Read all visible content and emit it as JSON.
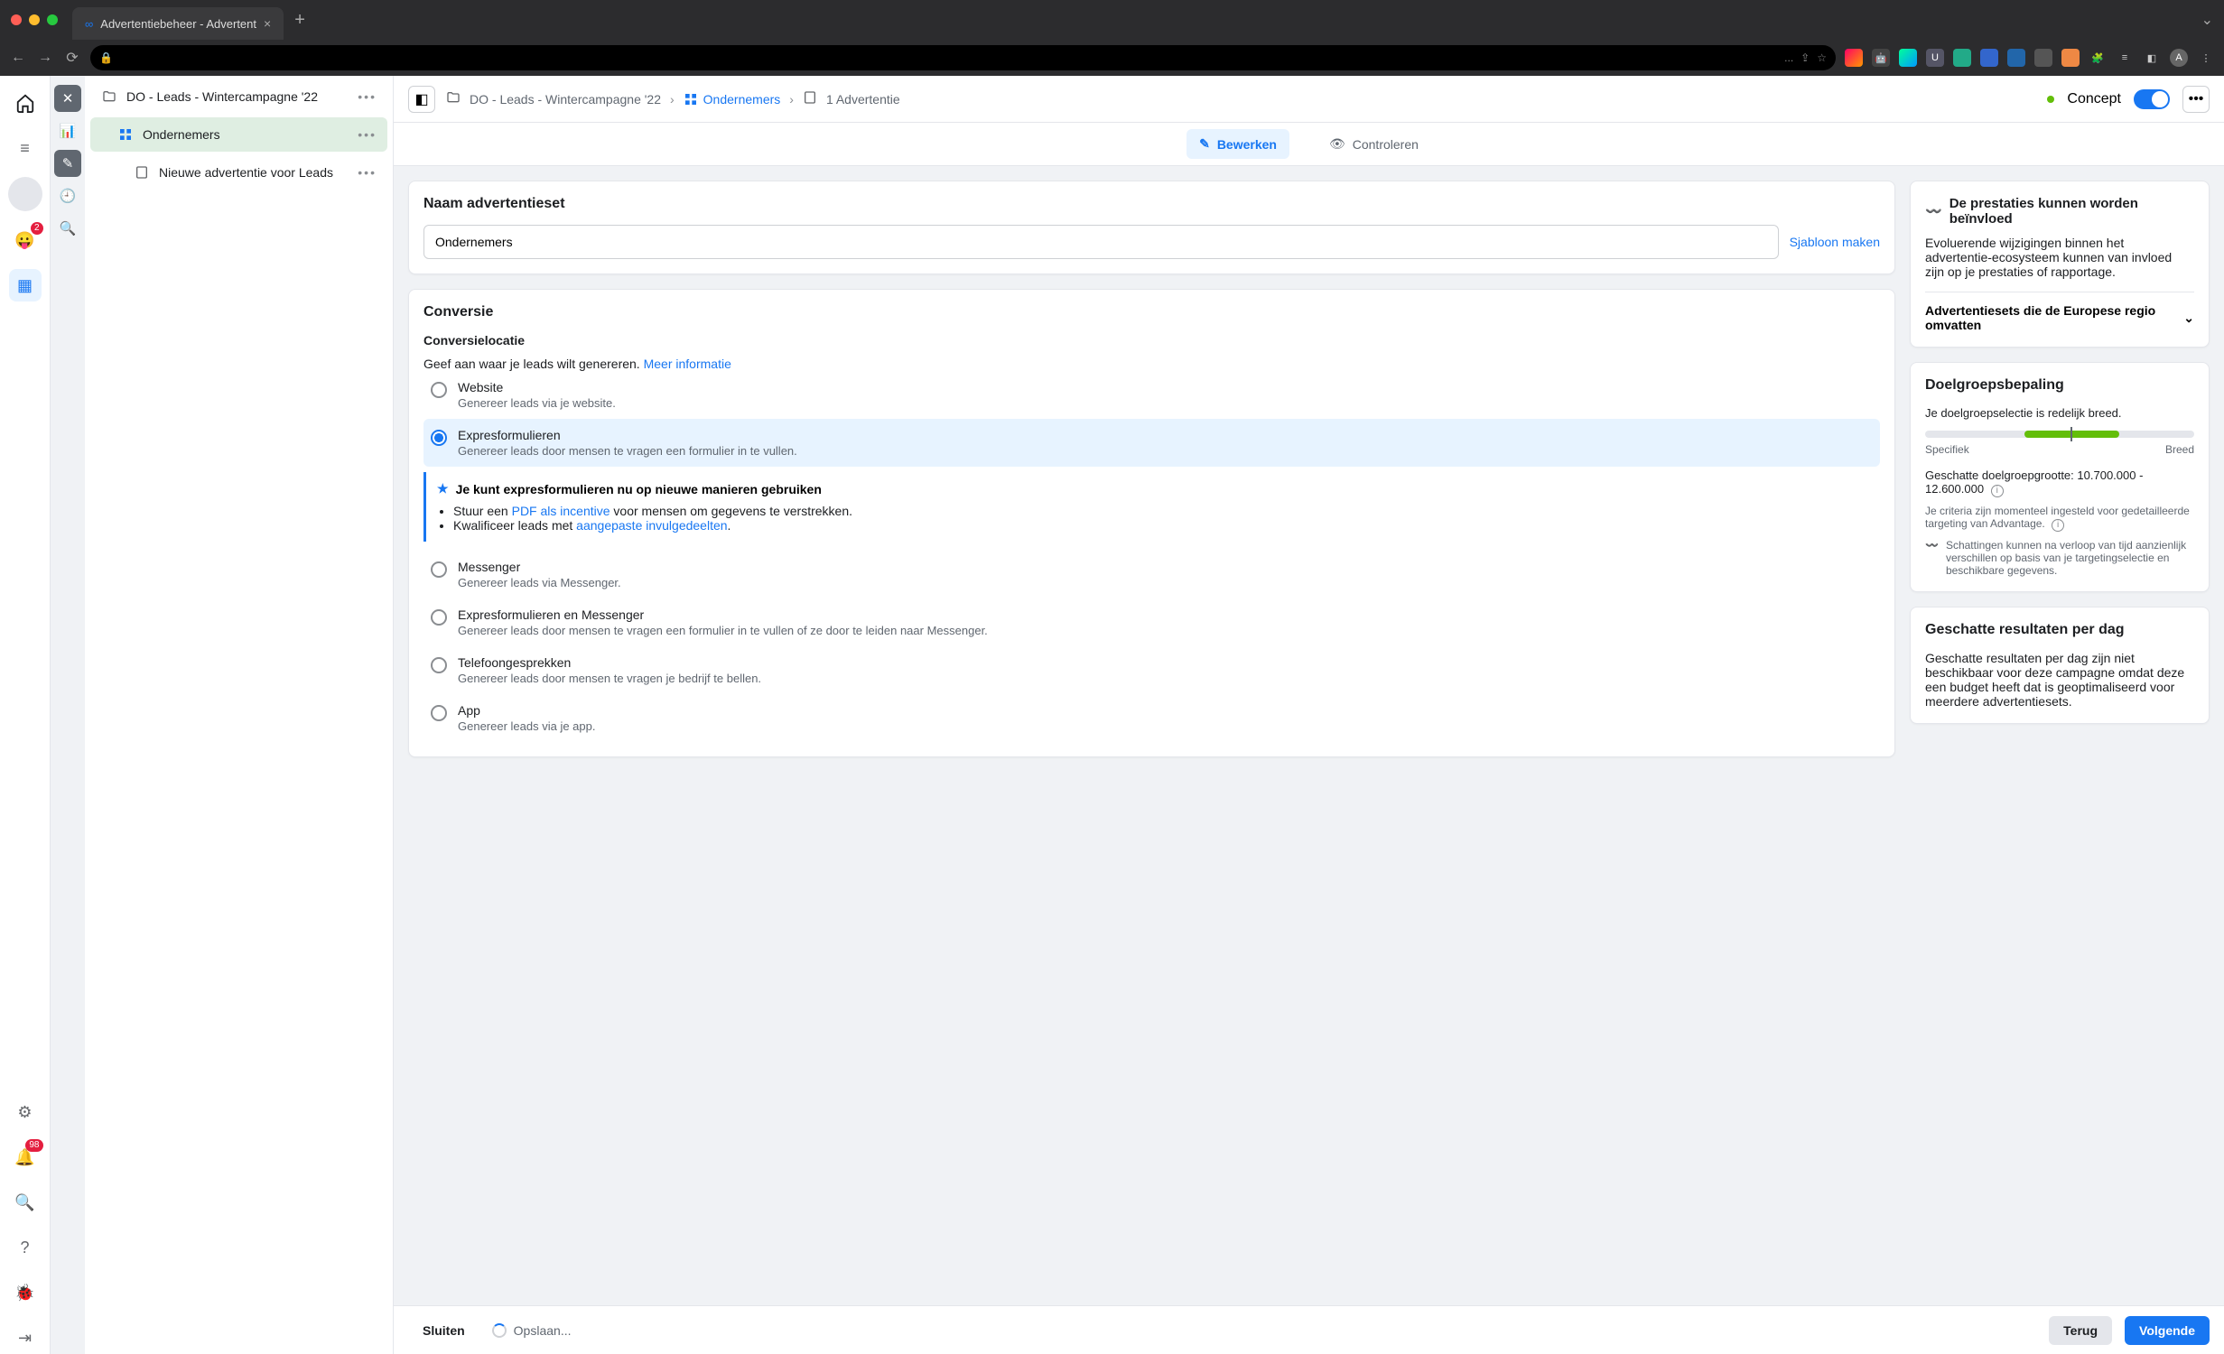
{
  "browser": {
    "tab_title": "Advertentiebeheer - Advertent",
    "url_ellipsis": "..."
  },
  "rail": {
    "badge_emoji": "2",
    "badge_bell": "98"
  },
  "tree": {
    "campaign": "DO - Leads - Wintercampagne '22",
    "adset": "Ondernemers",
    "ad": "Nieuwe advertentie voor Leads"
  },
  "breadcrumb": {
    "campaign": "DO - Leads - Wintercampagne '22",
    "adset": "Ondernemers",
    "ad_count": "1 Advertentie",
    "status": "Concept"
  },
  "tabs": {
    "edit": "Bewerken",
    "review": "Controleren"
  },
  "adset_name": {
    "label": "Naam advertentieset",
    "value": "Ondernemers",
    "template_link": "Sjabloon maken"
  },
  "conversion": {
    "heading": "Conversie",
    "location_label": "Conversielocatie",
    "hint": "Geef aan waar je leads wilt genereren.",
    "more_info": "Meer informatie",
    "options": [
      {
        "title": "Website",
        "desc": "Genereer leads via je website."
      },
      {
        "title": "Expresformulieren",
        "desc": "Genereer leads door mensen te vragen een formulier in te vullen."
      },
      {
        "title": "Messenger",
        "desc": "Genereer leads via Messenger."
      },
      {
        "title": "Expresformulieren en Messenger",
        "desc": "Genereer leads door mensen te vragen een formulier in te vullen of ze door te leiden naar Messenger."
      },
      {
        "title": "Telefoongesprekken",
        "desc": "Genereer leads door mensen te vragen je bedrijf te bellen."
      },
      {
        "title": "App",
        "desc": "Genereer leads via je app."
      }
    ],
    "tip": {
      "title": "Je kunt expresformulieren nu op nieuwe manieren gebruiken",
      "b1_pre": "Stuur een ",
      "b1_link": "PDF als incentive",
      "b1_post": " voor mensen om gegevens te verstrekken.",
      "b2_pre": "Kwalificeer leads met ",
      "b2_link": "aangepaste invulgedeelten",
      "b2_post": "."
    }
  },
  "right": {
    "warn_title": "De prestaties kunnen worden beïnvloed",
    "warn_desc": "Evoluerende wijzigingen binnen het advertentie-ecosysteem kunnen van invloed zijn op je prestaties of rapportage.",
    "accordion": "Advertentiesets die de Europese regio omvatten",
    "aud_heading": "Doelgroepsbepaling",
    "aud_desc": "Je doelgroepselectie is redelijk breed.",
    "aud_specific": "Specifiek",
    "aud_broad": "Breed",
    "est_label": "Geschatte doelgroepgrootte:",
    "est_value": "10.700.000 - 12.600.000",
    "criteria": "Je criteria zijn momenteel ingesteld voor gedetailleerde targeting van Advantage.",
    "note": "Schattingen kunnen na verloop van tijd aanzienlijk verschillen op basis van je targetingselectie en beschikbare gegevens.",
    "daily_heading": "Geschatte resultaten per dag",
    "daily_desc": "Geschatte resultaten per dag zijn niet beschikbaar voor deze campagne omdat deze een budget heeft dat is geoptimaliseerd voor meerdere advertentiesets."
  },
  "footer": {
    "close": "Sluiten",
    "saving": "Opslaan...",
    "back": "Terug",
    "next": "Volgende"
  }
}
